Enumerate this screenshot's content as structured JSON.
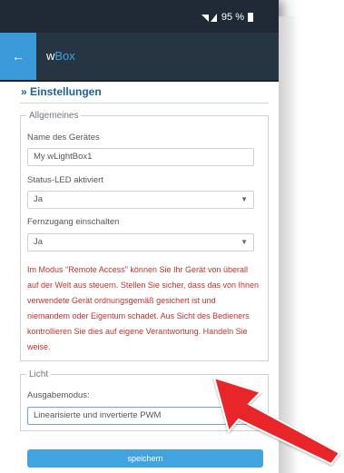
{
  "status_bar": {
    "signal_icon": "wifi-signal-icon",
    "battery_text": "95 %",
    "battery_icon": "battery-icon"
  },
  "app_bar": {
    "back_icon": "back-arrow-icon",
    "title_prefix": "w",
    "title_accent": "Box",
    "accent_color": "#3fa3e6"
  },
  "page": {
    "section_title": "» Einstellungen",
    "general": {
      "legend": "Allgemeines",
      "device_name_label": "Name des Gerätes",
      "device_name_value": "My wLightBox1",
      "status_led_label": "Status-LED aktiviert",
      "status_led_value": "Ja",
      "remote_label": "Fernzugang einschalten",
      "remote_value": "Ja",
      "warning": "Im Modus \"Remote Access\" können Sie Ihr Gerät von überall auf der Welt aus steuern. Stellen Sie sicher, dass das von Ihnen verwendete Gerät ordnungsgemäß gesichert ist und niemandem oder Eigentum schadet. Aus Sicht des Bedieners kontrollieren Sie dies auf eigene Verantwortung. Handeln Sie weise.",
      "warning_color": "#c0322b"
    },
    "light": {
      "legend": "Licht",
      "output_mode_label": "Ausgabemodus:",
      "output_mode_value": "Linearisierte und invertierte PWM"
    },
    "save_label": "speichern"
  },
  "annotation": {
    "arrow_color": "#e8262b"
  }
}
